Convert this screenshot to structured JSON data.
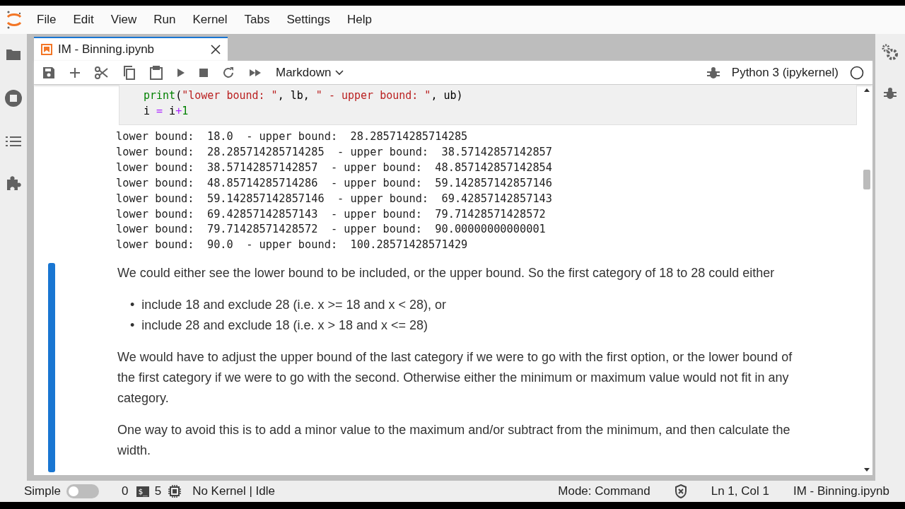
{
  "menu": [
    "File",
    "Edit",
    "View",
    "Run",
    "Kernel",
    "Tabs",
    "Settings",
    "Help"
  ],
  "tabs": [
    {
      "label": "IM - Binning.ipynb",
      "selected": true
    }
  ],
  "toolbar": {
    "cell_type": "Markdown",
    "kernel": "Python 3 (ipykernel)"
  },
  "code_lines": [
    [
      {
        "text": "print",
        "kind": "builtin"
      },
      {
        "text": "(",
        "kind": "plain"
      },
      {
        "text": "\"lower bound: \"",
        "kind": "string"
      },
      {
        "text": ", lb, ",
        "kind": "plain"
      },
      {
        "text": "\" - upper bound: \"",
        "kind": "string"
      },
      {
        "text": ", ub)",
        "kind": "plain"
      }
    ],
    [
      {
        "text": "i ",
        "kind": "plain"
      },
      {
        "text": "=",
        "kind": "operator"
      },
      {
        "text": " i",
        "kind": "plain"
      },
      {
        "text": "+",
        "kind": "operator"
      },
      {
        "text": "1",
        "kind": "number"
      }
    ]
  ],
  "output_lines": [
    "lower bound:  18.0  - upper bound:  28.285714285714285",
    "lower bound:  28.285714285714285  - upper bound:  38.57142857142857",
    "lower bound:  38.57142857142857  - upper bound:  48.857142857142854",
    "lower bound:  48.85714285714286  - upper bound:  59.142857142857146",
    "lower bound:  59.142857142857146  - upper bound:  69.42857142857143",
    "lower bound:  69.42857142857143  - upper bound:  79.71428571428572",
    "lower bound:  79.71428571428572  - upper bound:  90.00000000000001",
    "lower bound:  90.0  - upper bound:  100.28571428571429"
  ],
  "markdown": {
    "selected": true,
    "blocks": [
      {
        "kind": "paragraph",
        "text": "We could either see the lower bound to be included, or the upper bound. So the first category of 18 to 28 could either"
      },
      {
        "kind": "list",
        "marker": "•",
        "items": [
          "include 18 and exclude 28 (i.e. x >= 18 and x < 28), or",
          "include 28 and exclude 18 (i.e. x > 18 and x <= 28)"
        ]
      },
      {
        "kind": "paragraph",
        "text": "We would have to adjust the upper bound of the last category if we were to go with the first option, or the lower bound of the first category if we were to go with the second. Otherwise either the minimum or maximum value would not fit in any category."
      },
      {
        "kind": "paragraph",
        "text": "One way to avoid this is to add a minor value to the maximum and/or subtract from the minimum, and then calculate the width."
      }
    ]
  },
  "status_bar": {
    "simple_mode": false,
    "label": "Simple",
    "terminals": "0",
    "terminal_icon": "$_",
    "kernels": "5",
    "kernel_status": "No Kernel | Idle",
    "mode": "Mode: Command",
    "position": "Ln 1, Col 1",
    "document": "IM - Binning.ipynb"
  }
}
